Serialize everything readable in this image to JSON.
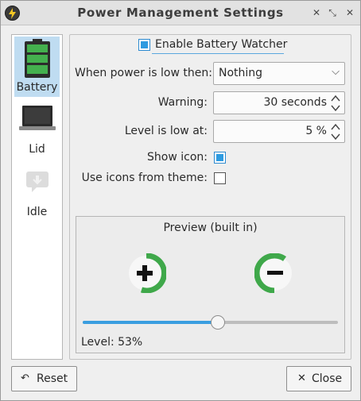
{
  "window": {
    "title": "Power Management Settings"
  },
  "sidebar": {
    "items": [
      {
        "label": "Battery",
        "icon": "battery-icon",
        "selected": true
      },
      {
        "label": "Lid",
        "icon": "laptop-lid-icon",
        "selected": false
      },
      {
        "label": "Idle",
        "icon": "idle-icon",
        "selected": false
      }
    ]
  },
  "battery": {
    "enable_label": "Enable Battery Watcher",
    "enable_checked": true,
    "when_low_label": "When power is low then:",
    "when_low_value": "Nothing",
    "warning_label": "Warning:",
    "warning_value": "30 seconds",
    "level_low_label": "Level is low at:",
    "level_low_value": "5 %",
    "show_icon_label": "Show icon:",
    "show_icon_checked": true,
    "theme_icons_label": "Use icons from theme:",
    "theme_icons_checked": false
  },
  "preview": {
    "title": "Preview (built in)",
    "level_text": "Level: 53%",
    "level_fraction": 0.53,
    "charging_icon": "battery-charging-icon",
    "discharging_icon": "battery-discharging-icon"
  },
  "buttons": {
    "reset_label": "Reset",
    "close_label": "Close"
  },
  "colors": {
    "accent": "#3a9ee0",
    "selection": "#bfdcf1",
    "battery_green": "#3fa84a"
  }
}
